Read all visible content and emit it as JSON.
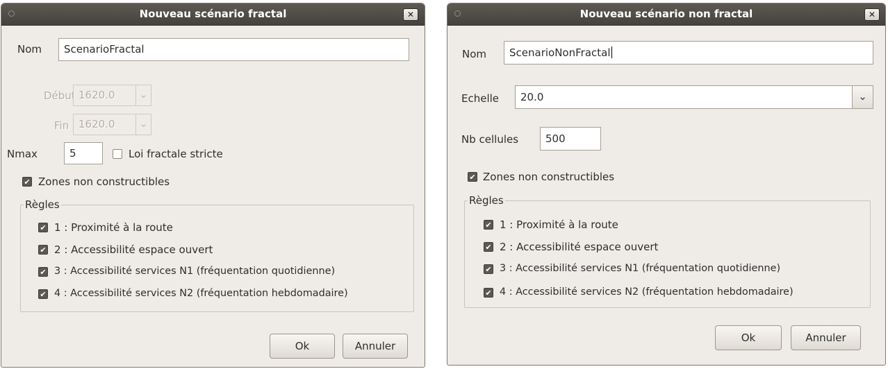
{
  "fractal": {
    "title": "Nouveau scénario fractal",
    "close_glyph": "✕",
    "nom_label": "Nom",
    "nom_value": "ScenarioFractal",
    "debut_label": "Début",
    "debut_value": "1620.0",
    "fin_label": "Fin",
    "fin_value": "1620.0",
    "nmax_label": "Nmax",
    "nmax_value": "5",
    "loi_label": "Loi fractale stricte",
    "loi_checked": false,
    "zones_label": "Zones non constructibles",
    "zones_checked": true,
    "regles_title": "Règles",
    "rules": [
      {
        "label": "1 : Proximité à la route",
        "checked": true
      },
      {
        "label": "2 : Accessibilité espace ouvert",
        "checked": true
      },
      {
        "label": "3 : Accessibilité services N1 (fréquentation quotidienne)",
        "checked": true
      },
      {
        "label": "4 : Accessibilité services N2 (fréquentation hebdomadaire)",
        "checked": true
      }
    ],
    "ok_label": "Ok",
    "cancel_label": "Annuler"
  },
  "nonfractal": {
    "title": "Nouveau scénario non fractal",
    "close_glyph": "✕",
    "nom_label": "Nom",
    "nom_value": "ScenarioNonFractal",
    "echelle_label": "Echelle",
    "echelle_value": "20.0",
    "nbcell_label": "Nb cellules",
    "nbcell_value": "500",
    "zones_label": "Zones non constructibles",
    "zones_checked": true,
    "regles_title": "Règles",
    "rules": [
      {
        "label": "1 : Proximité à la route",
        "checked": true
      },
      {
        "label": "2 : Accessibilité espace ouvert",
        "checked": true
      },
      {
        "label": "3 : Accessibilité services N1 (fréquentation quotidienne)",
        "checked": true
      },
      {
        "label": "4 : Accessibilité services N2 (fréquentation hebdomadaire)",
        "checked": true
      }
    ],
    "ok_label": "Ok",
    "cancel_label": "Annuler"
  },
  "icons": {
    "check": "✔",
    "chevron_down": "⌄"
  }
}
